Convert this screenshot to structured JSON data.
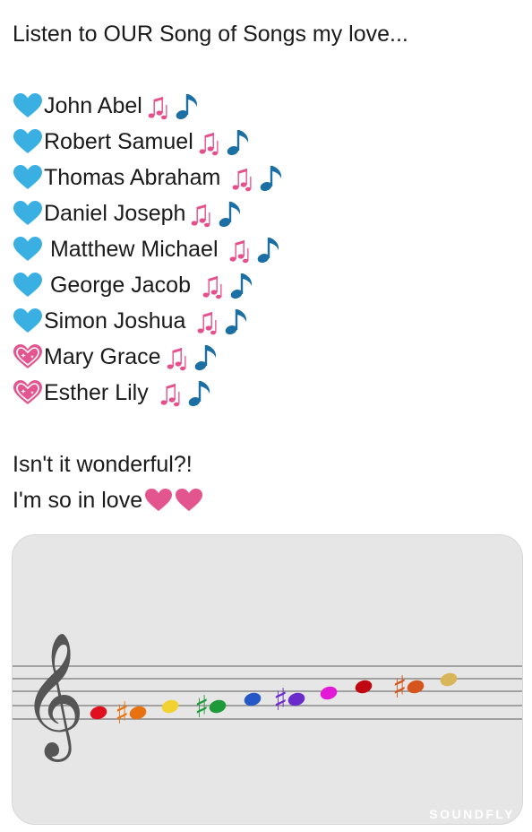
{
  "post": {
    "intro": "Listen to OUR Song of Songs my love...",
    "names": [
      {
        "name": "John Abel",
        "heart": "blue-heart"
      },
      {
        "name": "Robert Samuel",
        "heart": "blue-heart"
      },
      {
        "name": "Thomas Abraham ",
        "heart": "blue-heart"
      },
      {
        "name": "Daniel Joseph",
        "heart": "blue-heart"
      },
      {
        "name": " Matthew Michael ",
        "heart": "blue-heart"
      },
      {
        "name": " George Jacob ",
        "heart": "blue-heart"
      },
      {
        "name": "Simon Joshua ",
        "heart": "blue-heart"
      },
      {
        "name": "Mary Grace",
        "heart": "sparkling-heart"
      },
      {
        "name": "Esther Lily ",
        "heart": "sparkling-heart"
      }
    ],
    "outro_1": "Isn't it wonderful?!",
    "outro_2": "I'm so in love"
  },
  "media_card": {
    "brand": "SOUNDFLY",
    "image": "rainbow-chromatic-scale-on-treble-staff",
    "note_colors": [
      "#e0101e",
      "#e8720f",
      "#f2d230",
      "#1f9a3b",
      "#2557c7",
      "#6a2bcb",
      "#e21ad6",
      "#c00812",
      "#d6551c",
      "#d9b559"
    ]
  },
  "icons": {
    "blue_heart_color": "#3ab0e2",
    "pink_heart_color": "#e2558f",
    "notes_pink": "#e64f8c",
    "note_blue": "#1b6fa2"
  }
}
